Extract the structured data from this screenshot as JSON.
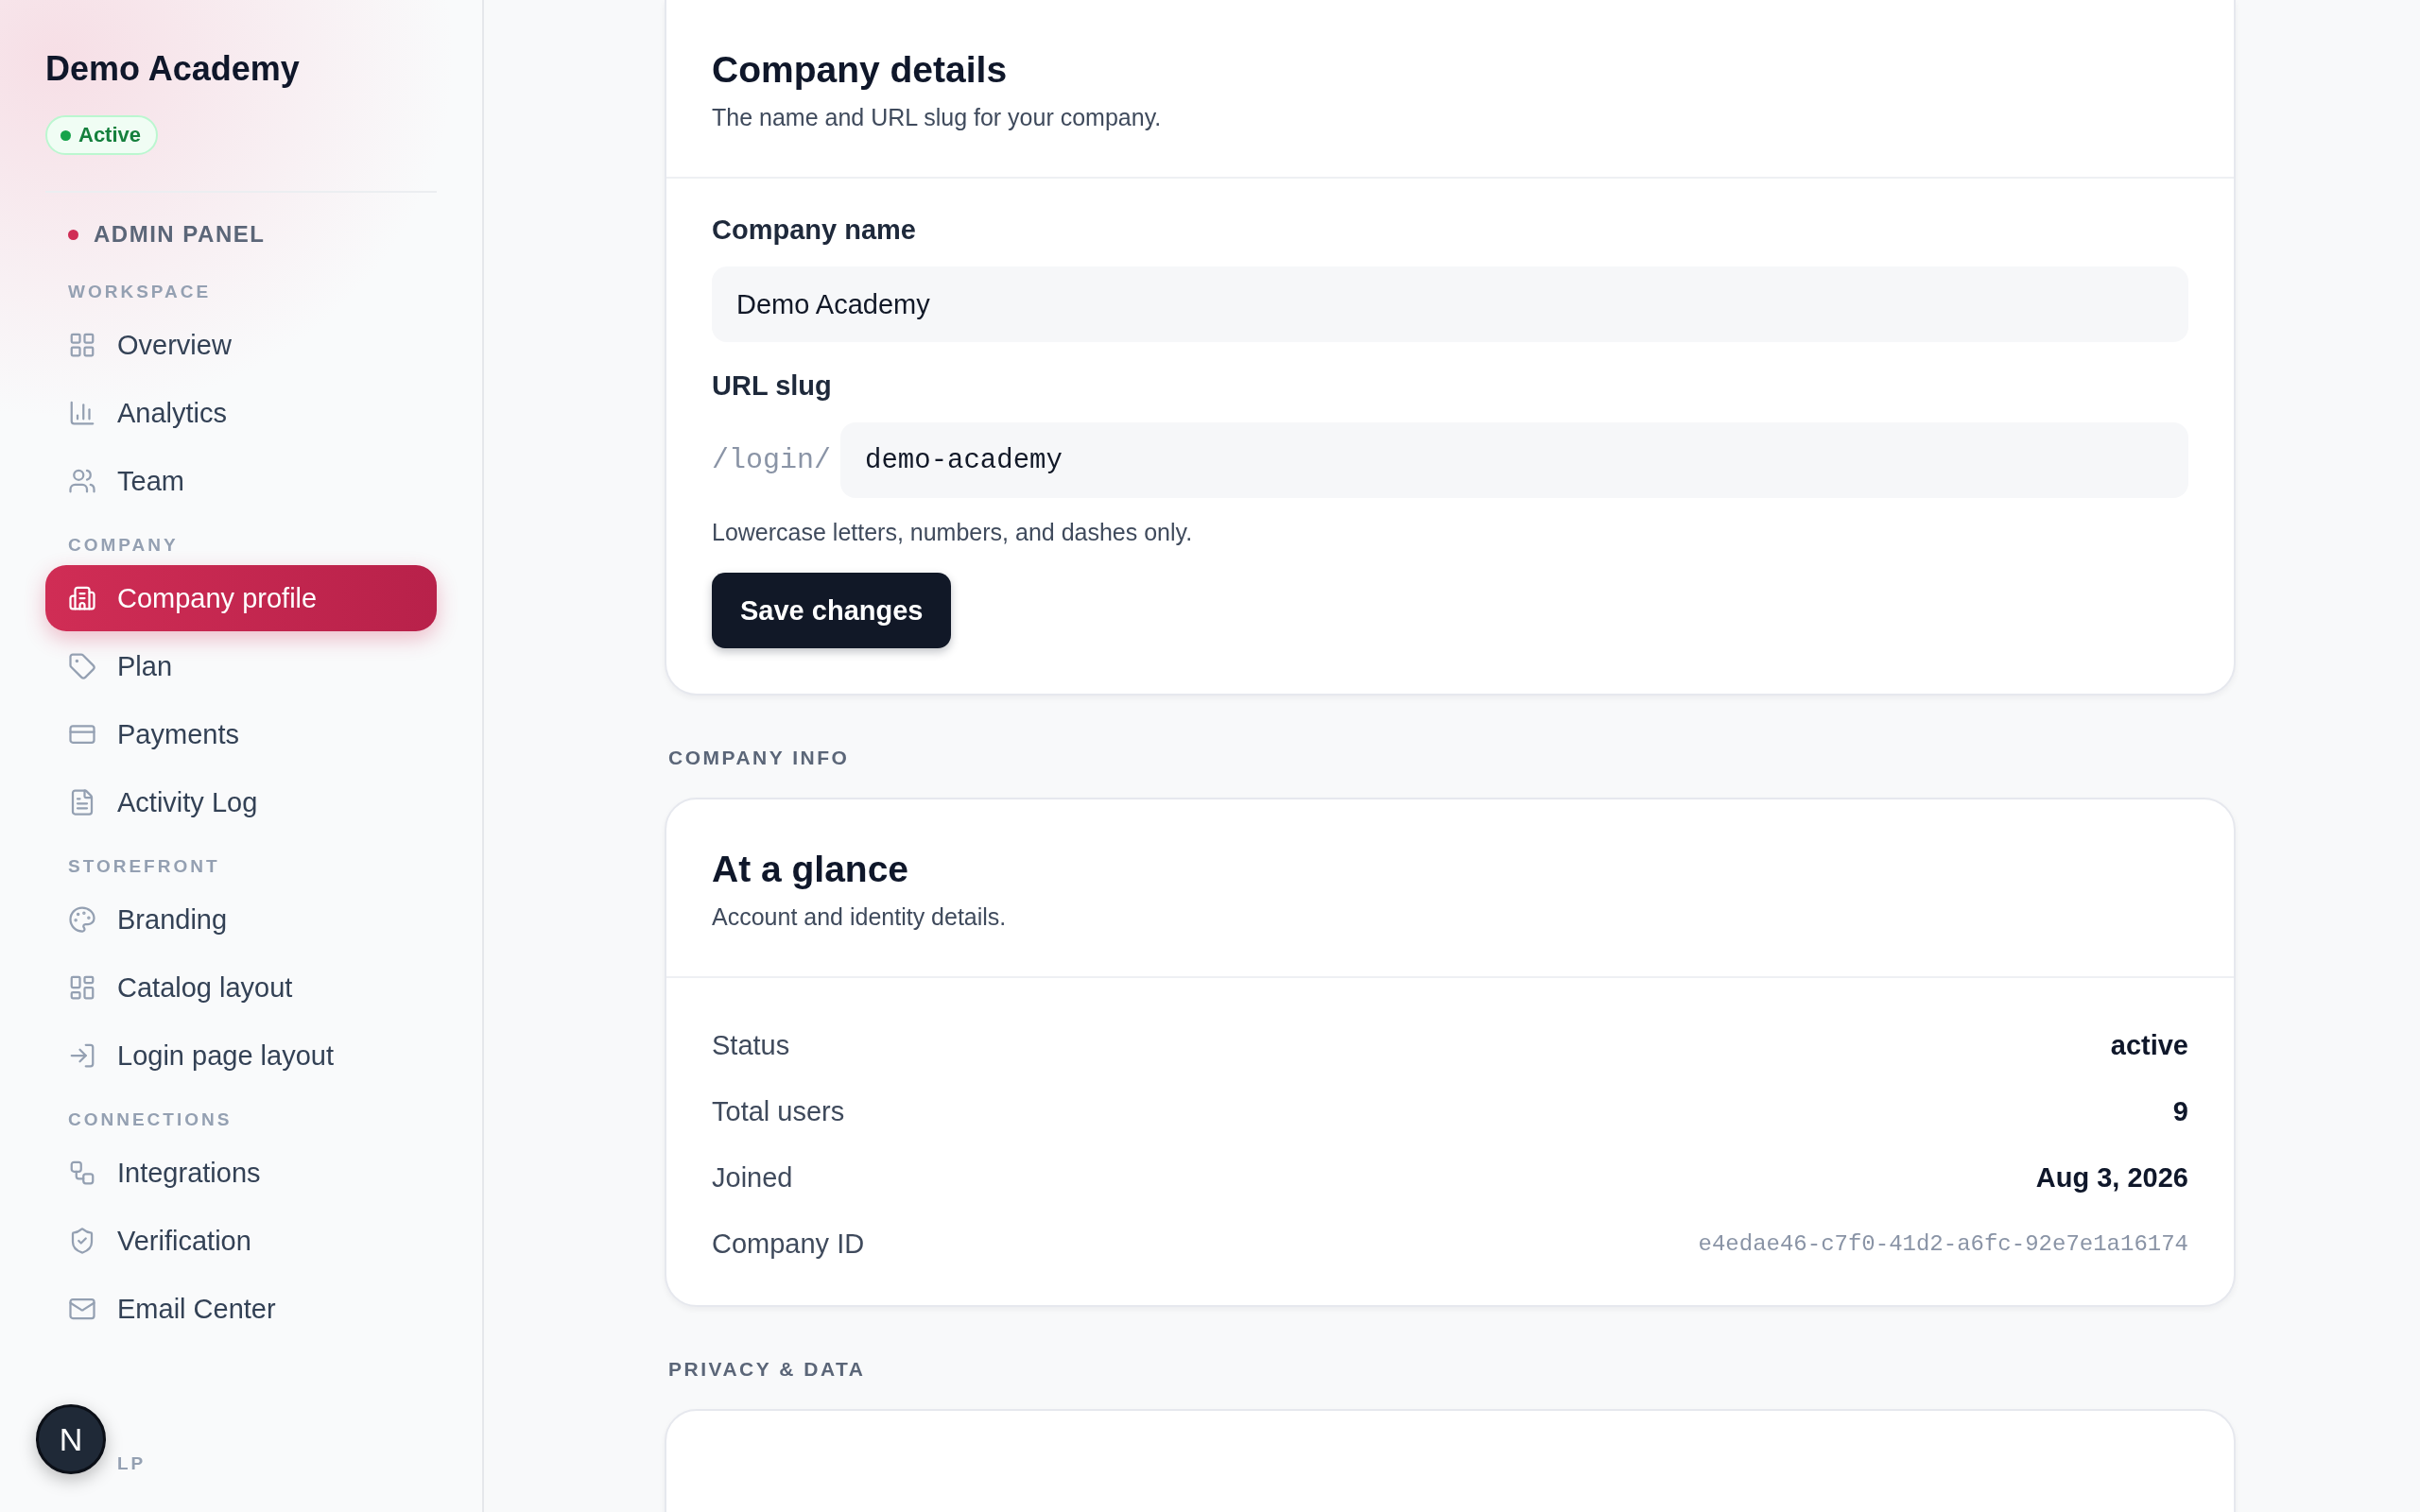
{
  "sidebar": {
    "org_name": "Demo Academy",
    "status_badge": "Active",
    "panel_label": "ADMIN PANEL",
    "sections": [
      {
        "title": "WORKSPACE",
        "items": [
          {
            "label": "Overview",
            "selected": false
          },
          {
            "label": "Analytics",
            "selected": false
          },
          {
            "label": "Team",
            "selected": false
          }
        ]
      },
      {
        "title": "COMPANY",
        "items": [
          {
            "label": "Company profile",
            "selected": true
          },
          {
            "label": "Plan",
            "selected": false
          },
          {
            "label": "Payments",
            "selected": false
          },
          {
            "label": "Activity Log",
            "selected": false
          }
        ]
      },
      {
        "title": "STOREFRONT",
        "items": [
          {
            "label": "Branding",
            "selected": false
          },
          {
            "label": "Catalog layout",
            "selected": false
          },
          {
            "label": "Login page layout",
            "selected": false
          }
        ]
      },
      {
        "title": "CONNECTIONS",
        "items": [
          {
            "label": "Integrations",
            "selected": false
          },
          {
            "label": "Verification",
            "selected": false
          },
          {
            "label": "Email Center",
            "selected": false
          }
        ]
      }
    ],
    "partial_section_title": "LP",
    "avatar_letter": "N"
  },
  "company_details": {
    "title": "Company details",
    "subtitle": "The name and URL slug for your company.",
    "name_label": "Company name",
    "name_value": "Demo Academy",
    "slug_label": "URL slug",
    "slug_prefix": "/login/",
    "slug_value": "demo-academy",
    "slug_hint": "Lowercase letters, numbers, and dashes only.",
    "save_button": "Save changes"
  },
  "company_info": {
    "section_title": "COMPANY INFO",
    "title": "At a glance",
    "subtitle": "Account and identity details.",
    "rows": [
      {
        "label": "Status",
        "value": "active",
        "kind": "strong"
      },
      {
        "label": "Total users",
        "value": "9",
        "kind": "strong"
      },
      {
        "label": "Joined",
        "value": "Aug 3, 2026",
        "kind": "strong"
      },
      {
        "label": "Company ID",
        "value": "e4edae46-c7f0-41d2-a6fc-92e7e1a16174",
        "kind": "code"
      }
    ]
  },
  "privacy": {
    "section_title": "PRIVACY & DATA"
  }
}
